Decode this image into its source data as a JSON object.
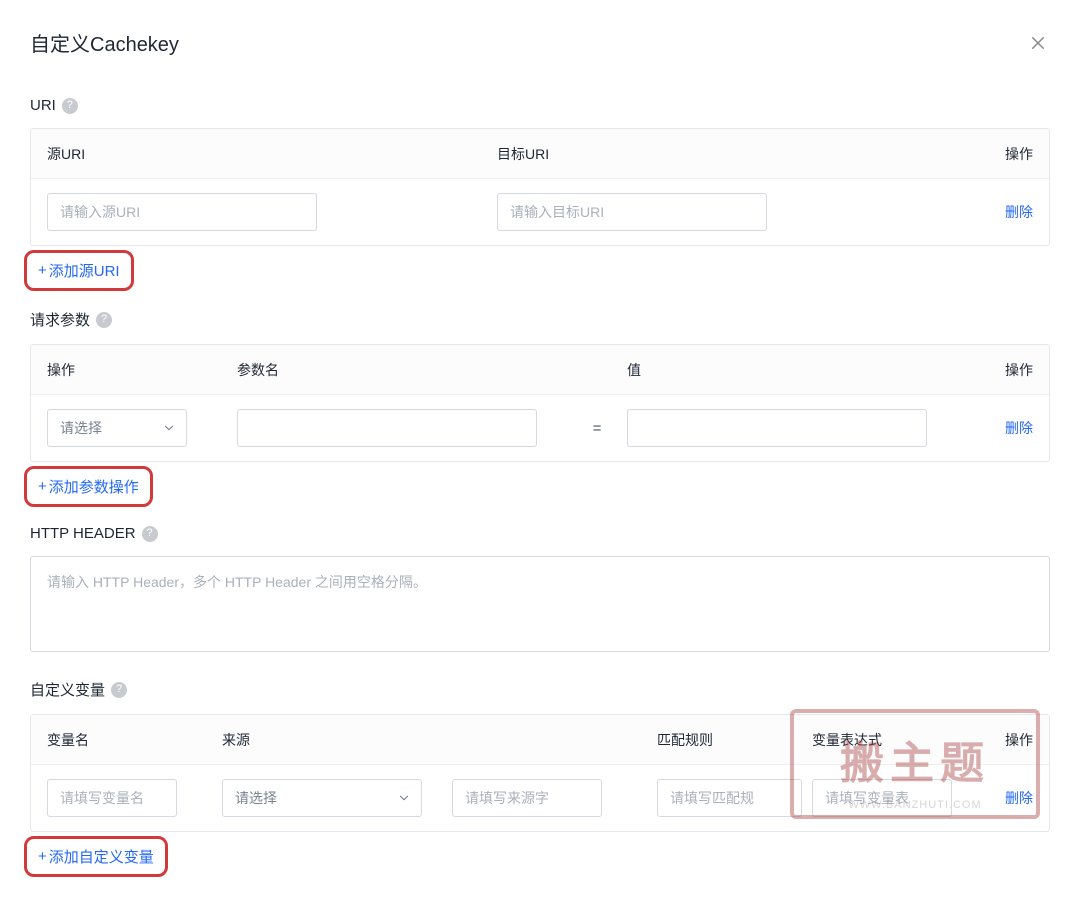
{
  "modal": {
    "title": "自定义Cachekey"
  },
  "uri": {
    "heading": "URI",
    "cols": {
      "source": "源URI",
      "target": "目标URI",
      "action": "操作"
    },
    "row": {
      "source_placeholder": "请输入源URI",
      "target_placeholder": "请输入目标URI",
      "delete": "删除"
    },
    "add_label": "添加源URI"
  },
  "params": {
    "heading": "请求参数",
    "cols": {
      "op": "操作",
      "name": "参数名",
      "value": "值",
      "action": "操作"
    },
    "row": {
      "select_placeholder": "请选择",
      "eq": "=",
      "delete": "删除"
    },
    "add_label": "添加参数操作"
  },
  "http_header": {
    "heading": "HTTP HEADER",
    "placeholder": "请输入 HTTP Header，多个 HTTP Header 之间用空格分隔。"
  },
  "vars": {
    "heading": "自定义变量",
    "cols": {
      "name": "变量名",
      "source": "来源",
      "rule": "匹配规则",
      "expr": "变量表达式",
      "action": "操作"
    },
    "row": {
      "name_placeholder": "请填写变量名",
      "select_placeholder": "请选择",
      "src_placeholder": "请填写来源字",
      "rule_placeholder": "请填写匹配规",
      "expr_placeholder": "请填写变量表",
      "delete": "删除"
    },
    "add_label": "添加自定义变量"
  },
  "watermark": {
    "text": "搬主题",
    "url": "WWW.BANZHUTI.COM"
  }
}
